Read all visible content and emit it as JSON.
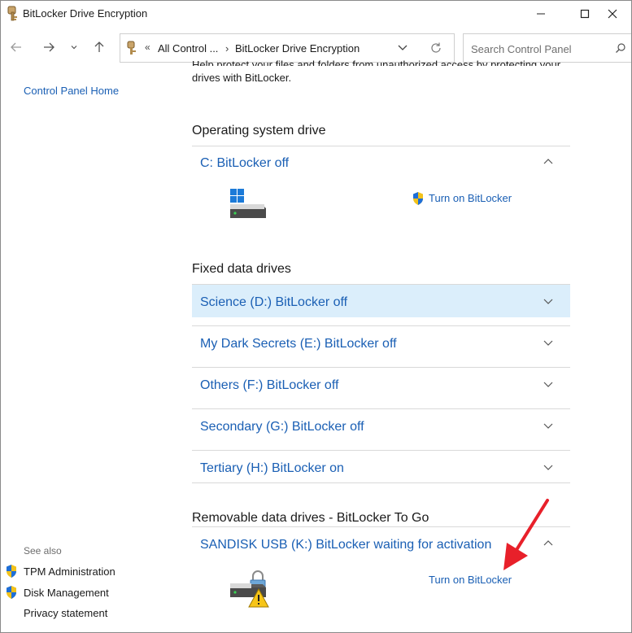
{
  "window": {
    "title": "BitLocker Drive Encryption",
    "icon": "bitlocker-key-icon"
  },
  "address_bar": {
    "chevron": "«",
    "crumb_1": "All Control ...",
    "separator": "›",
    "crumb_2": "BitLocker Drive Encryption"
  },
  "search": {
    "placeholder": "Search Control Panel"
  },
  "left_pane": {
    "home": "Control Panel Home",
    "see_also": "See also",
    "links": [
      "TPM Administration",
      "Disk Management",
      "Privacy statement"
    ]
  },
  "intro_text": "Help protect your files and folders from unauthorized access by protecting your drives with BitLocker.",
  "sections": {
    "os": "Operating system drive",
    "fixed": "Fixed data drives",
    "removable": "Removable data drives - BitLocker To Go"
  },
  "os_drive": {
    "label": "C: BitLocker off",
    "action": "Turn on BitLocker"
  },
  "fixed_drives": [
    "Science (D:) BitLocker off",
    "My Dark Secrets (E:) BitLocker off",
    "Others (F:) BitLocker off",
    "Secondary (G:) BitLocker off",
    "Tertiary (H:) BitLocker on"
  ],
  "removable_drive": {
    "label": "SANDISK USB (K:) BitLocker waiting for activation",
    "action": "Turn on BitLocker"
  },
  "colors": {
    "link": "#1a5fb4",
    "highlight_row": "#dbeefb",
    "arrow": "#e8202a"
  }
}
